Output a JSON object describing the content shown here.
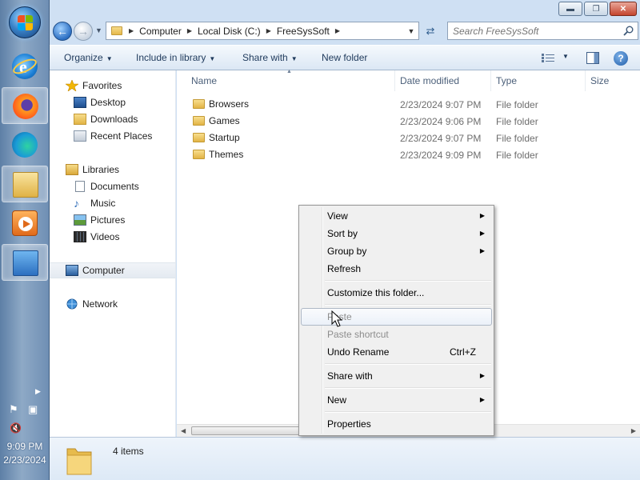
{
  "taskbar": {
    "apps": [
      {
        "name": "internet-explorer-icon"
      },
      {
        "name": "firefox-icon"
      },
      {
        "name": "edge-icon"
      },
      {
        "name": "windows-explorer-icon"
      },
      {
        "name": "media-player-icon"
      },
      {
        "name": "control-panel-icon"
      }
    ],
    "clock_time": "9:09 PM",
    "clock_date": "2/23/2024"
  },
  "window": {
    "breadcrumbs": [
      "Computer",
      "Local Disk (C:)",
      "FreeSysSoft"
    ],
    "search_placeholder": "Search FreeSysSoft",
    "toolbar": {
      "organize": "Organize",
      "include_in_library": "Include in library",
      "share_with": "Share with",
      "new_folder": "New folder"
    }
  },
  "navpane": {
    "favorites": "Favorites",
    "desktop": "Desktop",
    "downloads": "Downloads",
    "recent_places": "Recent Places",
    "libraries": "Libraries",
    "documents": "Documents",
    "music": "Music",
    "pictures": "Pictures",
    "videos": "Videos",
    "computer": "Computer",
    "network": "Network"
  },
  "columns": {
    "name": "Name",
    "date_modified": "Date modified",
    "type": "Type",
    "size": "Size"
  },
  "files": [
    {
      "name": "Browsers",
      "date": "2/23/2024 9:07 PM",
      "type": "File folder"
    },
    {
      "name": "Games",
      "date": "2/23/2024 9:06 PM",
      "type": "File folder"
    },
    {
      "name": "Startup",
      "date": "2/23/2024 9:07 PM",
      "type": "File folder"
    },
    {
      "name": "Themes",
      "date": "2/23/2024 9:09 PM",
      "type": "File folder"
    }
  ],
  "status": {
    "item_count": "4 items"
  },
  "context_menu": {
    "view": "View",
    "sort_by": "Sort by",
    "group_by": "Group by",
    "refresh": "Refresh",
    "customize": "Customize this folder...",
    "paste": "Paste",
    "paste_shortcut": "Paste shortcut",
    "undo_rename": "Undo Rename",
    "undo_shortcut": "Ctrl+Z",
    "share_with": "Share with",
    "new": "New",
    "properties": "Properties"
  },
  "colors": {
    "accent": "#1e395b",
    "folder": "#e8bd4f",
    "selection": "#cce8ff"
  }
}
